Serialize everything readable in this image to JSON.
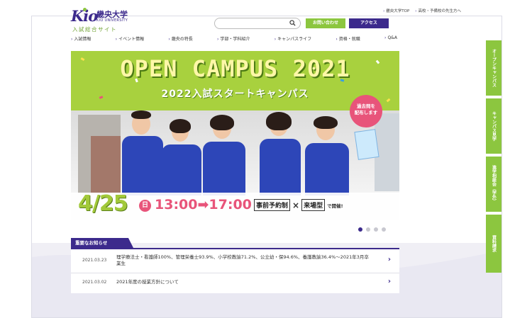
{
  "logo": {
    "kio": "Kio",
    "name": "畿央大学",
    "english": "KIO UNIVERSITY",
    "site": "入試総合サイト"
  },
  "toplinks": [
    {
      "arrow": "›",
      "label": "畿央大学TOP"
    },
    {
      "arrow": "›",
      "label": "高校・予備校の先生方へ"
    }
  ],
  "search": {
    "placeholder": "",
    "icon": "search-icon"
  },
  "buttons": {
    "contact": "お問い合わせ",
    "access": "アクセス"
  },
  "gnav": [
    {
      "arrow": "›",
      "label": "入試情報"
    },
    {
      "arrow": "›",
      "label": "イベント情報"
    },
    {
      "arrow": "›",
      "label": "畿央の特長"
    },
    {
      "arrow": "›",
      "label": "学部・学科紹介"
    },
    {
      "arrow": "›",
      "label": "キャンパスライフ"
    },
    {
      "arrow": "›",
      "label": "資格・就職"
    },
    {
      "arrow": "›",
      "label": "Q&A"
    }
  ],
  "hero": {
    "title": "OPEN CAMPUS 2021",
    "subtitle": "2022入試スタートキャンパス",
    "badge_line1": "過去問を",
    "badge_line2": "配布します",
    "date": "4/25",
    "day": "日",
    "time": "13:00➡17:00",
    "reserve_1": "事前予約制",
    "reserve_x": "×",
    "reserve_2": "来場型",
    "reserve_tail": "で開催!"
  },
  "slider": {
    "count": 4,
    "active": 0
  },
  "news": {
    "heading": "重要なお知らせ",
    "items": [
      {
        "date": "2021.03.23",
        "text": "理学療法士・看護師100%、管理栄養士93.9%、小学校教諭71.2%、公立幼・保94.6%、養護教諭36.4%～2021年3月卒業生"
      },
      {
        "date": "2021.03.02",
        "text": "2021年度の授業方針について"
      }
    ],
    "chevron": "›"
  },
  "side_tabs": [
    "オープンキャンパス",
    "キャンパス見学",
    "進学相談会（学外）",
    "資料請求"
  ],
  "colors": {
    "brand_purple": "#3c2a8c",
    "brand_green": "#8cc63f",
    "accent_pink": "#e8547a"
  }
}
